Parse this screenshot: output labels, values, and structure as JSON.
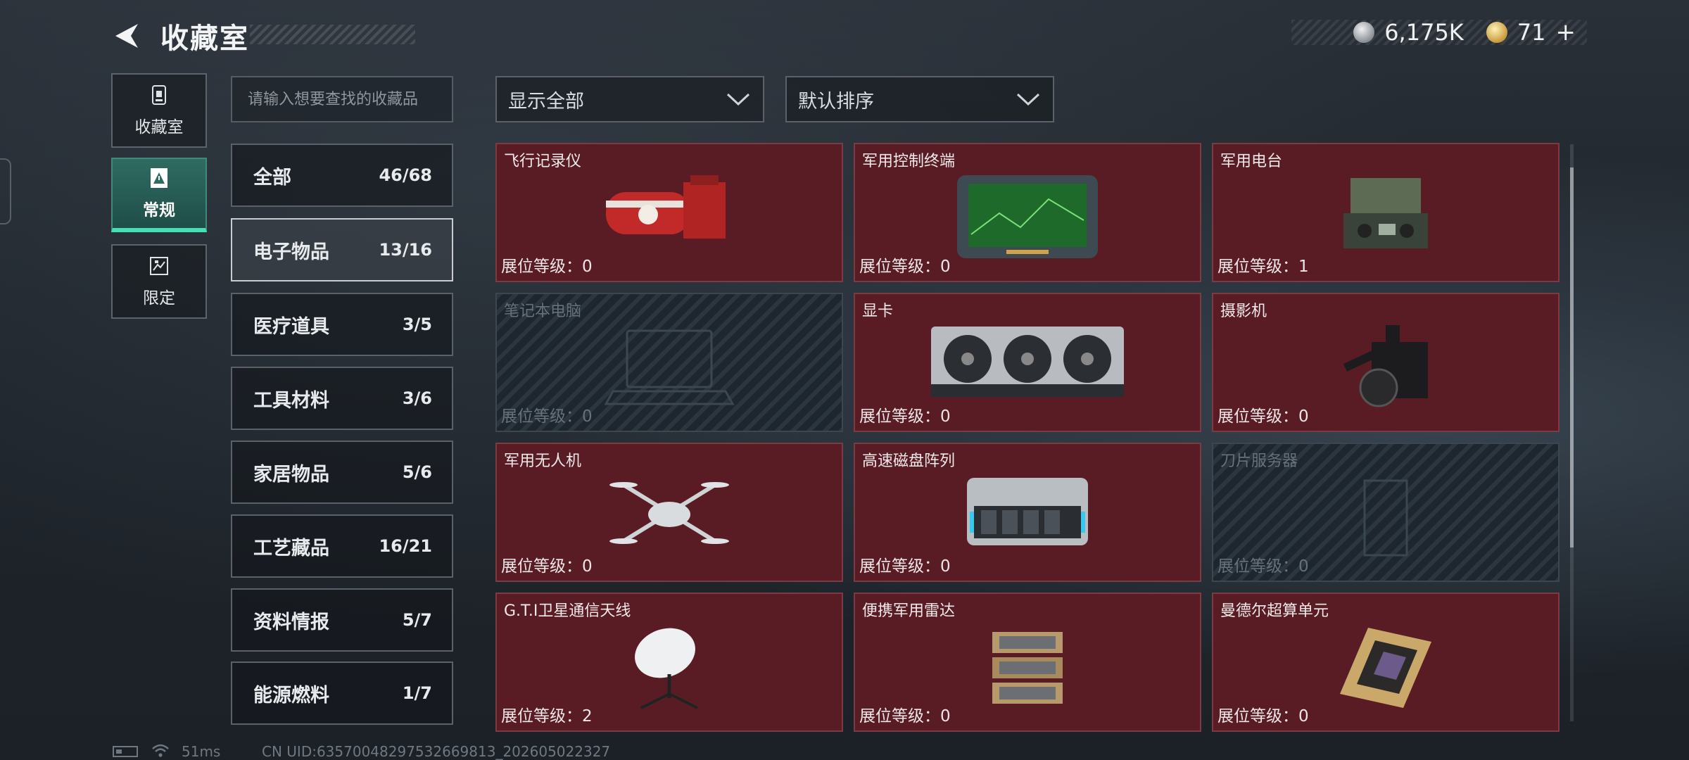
{
  "header": {
    "title": "收藏室",
    "currency_silver": "6,175K",
    "currency_gold": "71",
    "gold_add": "+"
  },
  "side_nav": [
    {
      "label": "收藏室",
      "icon": "trophy-icon"
    },
    {
      "label": "常规",
      "icon": "warning-card-icon"
    },
    {
      "label": "限定",
      "icon": "limited-card-icon"
    }
  ],
  "search": {
    "placeholder": "请输入想要查找的收藏品"
  },
  "categories": [
    {
      "name": "全部",
      "count": "46/68"
    },
    {
      "name": "电子物品",
      "count": "13/16"
    },
    {
      "name": "医疗道具",
      "count": "3/5"
    },
    {
      "name": "工具材料",
      "count": "3/6"
    },
    {
      "name": "家居物品",
      "count": "5/6"
    },
    {
      "name": "工艺藏品",
      "count": "16/21"
    },
    {
      "name": "资料情报",
      "count": "5/7"
    },
    {
      "name": "能源燃料",
      "count": "1/7"
    }
  ],
  "filters": {
    "show": "显示全部",
    "sort": "默认排序"
  },
  "level_label": "展位等级：",
  "items": [
    {
      "name": "飞行记录仪",
      "level": "0"
    },
    {
      "name": "军用控制终端",
      "level": "0"
    },
    {
      "name": "军用电台",
      "level": "1"
    },
    {
      "name": "笔记本电脑",
      "level": "0"
    },
    {
      "name": "显卡",
      "level": "0"
    },
    {
      "name": "摄影机",
      "level": "0"
    },
    {
      "name": "军用无人机",
      "level": "0"
    },
    {
      "name": "高速磁盘阵列",
      "level": "0"
    },
    {
      "name": "刀片服务器",
      "level": "0"
    },
    {
      "name": "G.T.I卫星通信天线",
      "level": "2"
    },
    {
      "name": "便携军用雷达",
      "level": "0"
    },
    {
      "name": "曼德尔超算单元",
      "level": "0"
    }
  ],
  "footer": {
    "ping": "51ms",
    "uid": "CN UID:6357004829753266981​3_202605022327"
  },
  "colors": {
    "owned_card": "#5a1c24",
    "active_tab": "#47e0b5"
  }
}
